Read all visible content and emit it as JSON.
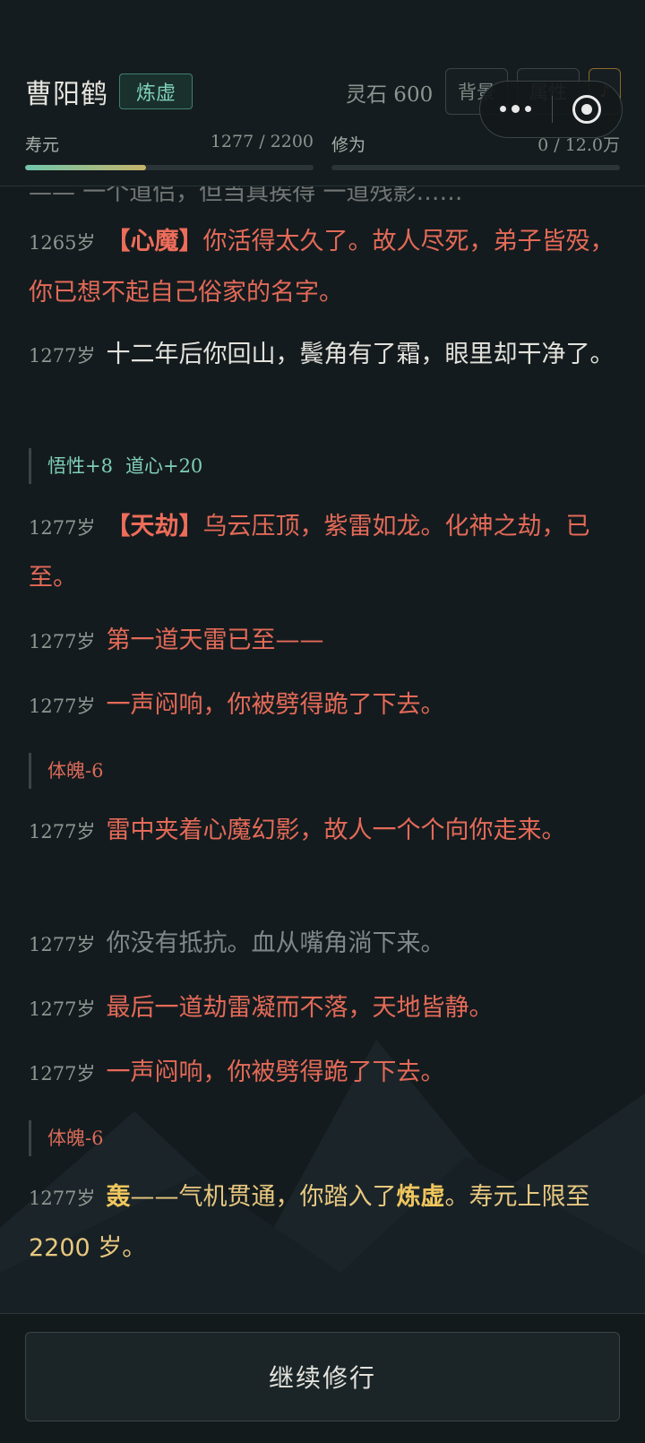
{
  "header": {
    "name": "曹阳鹤",
    "realm": "炼虚",
    "spirit_stone": "灵石 600",
    "background_button": "背景",
    "attributes_button": "属性",
    "music_icon": "♪",
    "lifespan_label": "寿元",
    "lifespan_value": "1277 / 2200",
    "lifespan_progress": 0.42,
    "cultivation_label": "修为",
    "cultivation_value": "0 / 12.0万",
    "cultivation_progress": 0
  },
  "log": {
    "cut_text": "—— 一个道侣，但当真挨得 一道残影……",
    "entries": [
      {
        "age": "1265岁",
        "tag": "【心魔】",
        "text": "你活得太久了。故人尽死，弟子皆殁，你已想不起自己俗家的名字。"
      },
      {
        "age": "1277岁",
        "text": "十二年后你回山，鬓角有了霜，眼里却干净了。"
      },
      {
        "deltas": [
          "悟性+8",
          "道心+20"
        ]
      },
      {
        "age": "1277岁",
        "tag": "【天劫】",
        "text": "乌云压顶，紫雷如龙。化神之劫，已至。"
      },
      {
        "age": "1277岁",
        "text": "第一道天雷已至——"
      },
      {
        "age": "1277岁",
        "text": "一声闷响，你被劈得跪了下去。"
      },
      {
        "deltas": [
          "体魄-6"
        ]
      },
      {
        "age": "1277岁",
        "text": "雷中夹着心魔幻影，故人一个个向你走来。"
      },
      {
        "age": "1277岁",
        "text": "你没有抵抗。血从嘴角淌下来。"
      },
      {
        "age": "1277岁",
        "text": "最后一道劫雷凝而不落，天地皆静。"
      },
      {
        "age": "1277岁",
        "text": "一声闷响，你被劈得跪了下去。"
      },
      {
        "deltas": [
          "体魄-6"
        ]
      },
      {
        "age": "1277岁",
        "lead": "轰",
        "text_a": "——气机贯通，你踏入了",
        "realm": "炼虚",
        "text_b": "。寿元上限至 2200 岁。"
      }
    ]
  },
  "footer": {
    "continue_label": "继续修行"
  },
  "colors": {
    "background": "#141b1e",
    "danger_text": "#e46a58",
    "gain_text": "#7fcfb6",
    "gold_text": "#f0c65e"
  },
  "icons": {
    "menu": "more-dots-icon",
    "close": "target-close-icon",
    "music": "music-note-icon"
  }
}
